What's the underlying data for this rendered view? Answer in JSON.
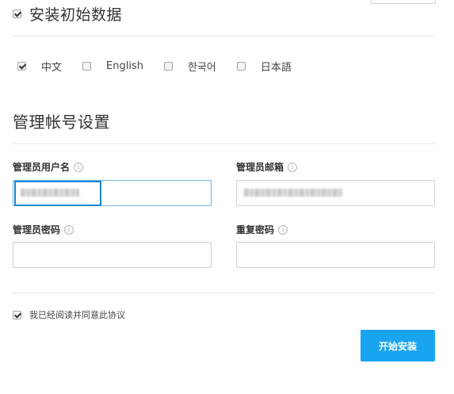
{
  "install_data": {
    "checked": true,
    "label": "安装初始数据"
  },
  "languages": [
    {
      "label": "中文",
      "checked": true
    },
    {
      "label": "English",
      "checked": false
    },
    {
      "label": "한국어",
      "checked": false
    },
    {
      "label": "日本語",
      "checked": false
    }
  ],
  "admin_section": {
    "title": "管理帐号设置",
    "username": {
      "label": "管理员用户名",
      "value": ""
    },
    "email": {
      "label": "管理员邮箱",
      "value": ""
    },
    "password": {
      "label": "管理员密码",
      "value": ""
    },
    "confirm_password": {
      "label": "重复密码",
      "value": ""
    },
    "info_icon_glyph": "i"
  },
  "agreement": {
    "checked": true,
    "label": "我已经阅读并同意此协议"
  },
  "start_button_label": "开始安装",
  "colors": {
    "accent": "#19a4ef",
    "focus": "#1a87d6"
  }
}
